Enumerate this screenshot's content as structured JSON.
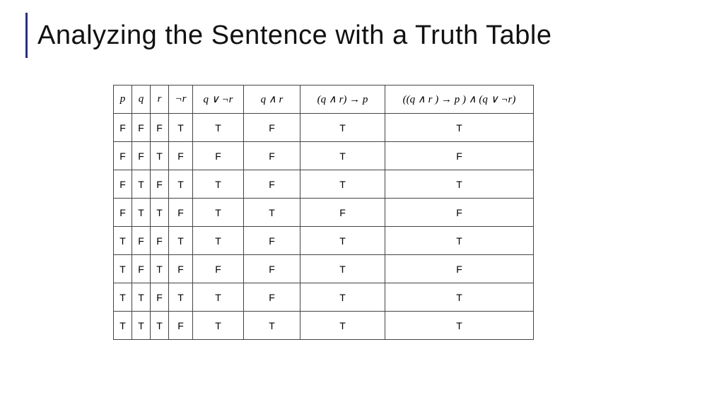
{
  "title": "Analyzing the Sentence with a Truth Table",
  "chart_data": {
    "type": "table",
    "headers": [
      "p",
      "q",
      "r",
      "¬r",
      "q ∨ ¬r",
      "q ∧ r",
      "(q ∧ r) → p",
      "((q ∧ r ) → p ) ∧ (q ∨ ¬r)"
    ],
    "rows": [
      [
        "F",
        "F",
        "F",
        "T",
        "T",
        "F",
        "T",
        "T"
      ],
      [
        "F",
        "F",
        "T",
        "F",
        "F",
        "F",
        "T",
        "F"
      ],
      [
        "F",
        "T",
        "F",
        "T",
        "T",
        "F",
        "T",
        "T"
      ],
      [
        "F",
        "T",
        "T",
        "F",
        "T",
        "T",
        "F",
        "F"
      ],
      [
        "T",
        "F",
        "F",
        "T",
        "T",
        "F",
        "T",
        "T"
      ],
      [
        "T",
        "F",
        "T",
        "F",
        "F",
        "F",
        "T",
        "F"
      ],
      [
        "T",
        "T",
        "F",
        "T",
        "T",
        "F",
        "T",
        "T"
      ],
      [
        "T",
        "T",
        "T",
        "F",
        "T",
        "T",
        "T",
        "T"
      ]
    ]
  }
}
